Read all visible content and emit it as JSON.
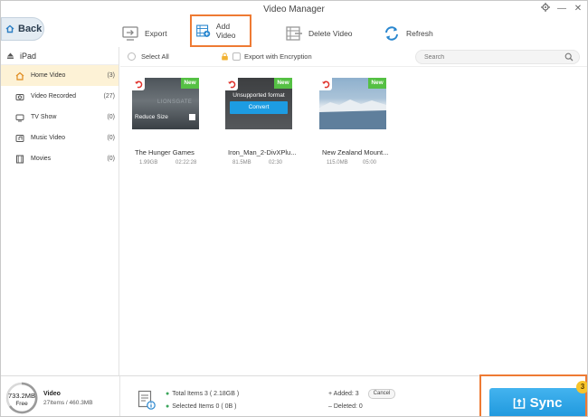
{
  "window": {
    "title": "Video Manager"
  },
  "nav": {
    "back_label": "Back"
  },
  "toolbar": {
    "export_label": "Export",
    "add_video_label": "Add Video",
    "delete_video_label": "Delete Video",
    "refresh_label": "Refresh"
  },
  "sidebar": {
    "device": "iPad",
    "items": [
      {
        "label": "Home Video",
        "count": "(3)",
        "icon": "home-video-icon",
        "active": true
      },
      {
        "label": "Video Recorded",
        "count": "(27)",
        "icon": "camera-icon",
        "active": false
      },
      {
        "label": "TV Show",
        "count": "(0)",
        "icon": "tv-icon",
        "active": false
      },
      {
        "label": "Music Video",
        "count": "(0)",
        "icon": "music-video-icon",
        "active": false
      },
      {
        "label": "Movies",
        "count": "(0)",
        "icon": "film-icon",
        "active": false
      }
    ]
  },
  "main": {
    "select_all_label": "Select All",
    "encrypt_label": "Export with Encryption",
    "search_placeholder": "Search",
    "videos": [
      {
        "title": "The Hunger Games",
        "size": "1.99GB",
        "duration": "02:22:28",
        "badge": "New",
        "overlay_text": "Reduce Size",
        "watermark": "LIONSGATE"
      },
      {
        "title": "Iron_Man_2-DivXPlu...",
        "size": "81.5MB",
        "duration": "02:30",
        "badge": "New",
        "overlay_text": "Unsupported format",
        "button_label": "Convert"
      },
      {
        "title": "New Zealand Mount...",
        "size": "115.0MB",
        "duration": "05:00",
        "badge": "New"
      }
    ]
  },
  "footer": {
    "storage_free": "733.2MB",
    "storage_free_label": "Free",
    "category_label": "Video",
    "category_detail": "27Items / 460.3MB",
    "total_items": "Total Items 3 ( 2.18GB )",
    "selected_items": "Selected Items 0 ( 0B )",
    "added": "Added: 3",
    "deleted": "Deleted: 0",
    "cancel_label": "Cancel",
    "sync_label": "Sync",
    "sync_badge": "3"
  },
  "colors": {
    "accent_orange": "#ee7a33",
    "sync_blue": "#1f98dd",
    "new_badge_green": "#55c044",
    "active_row": "#fdf2d6"
  }
}
